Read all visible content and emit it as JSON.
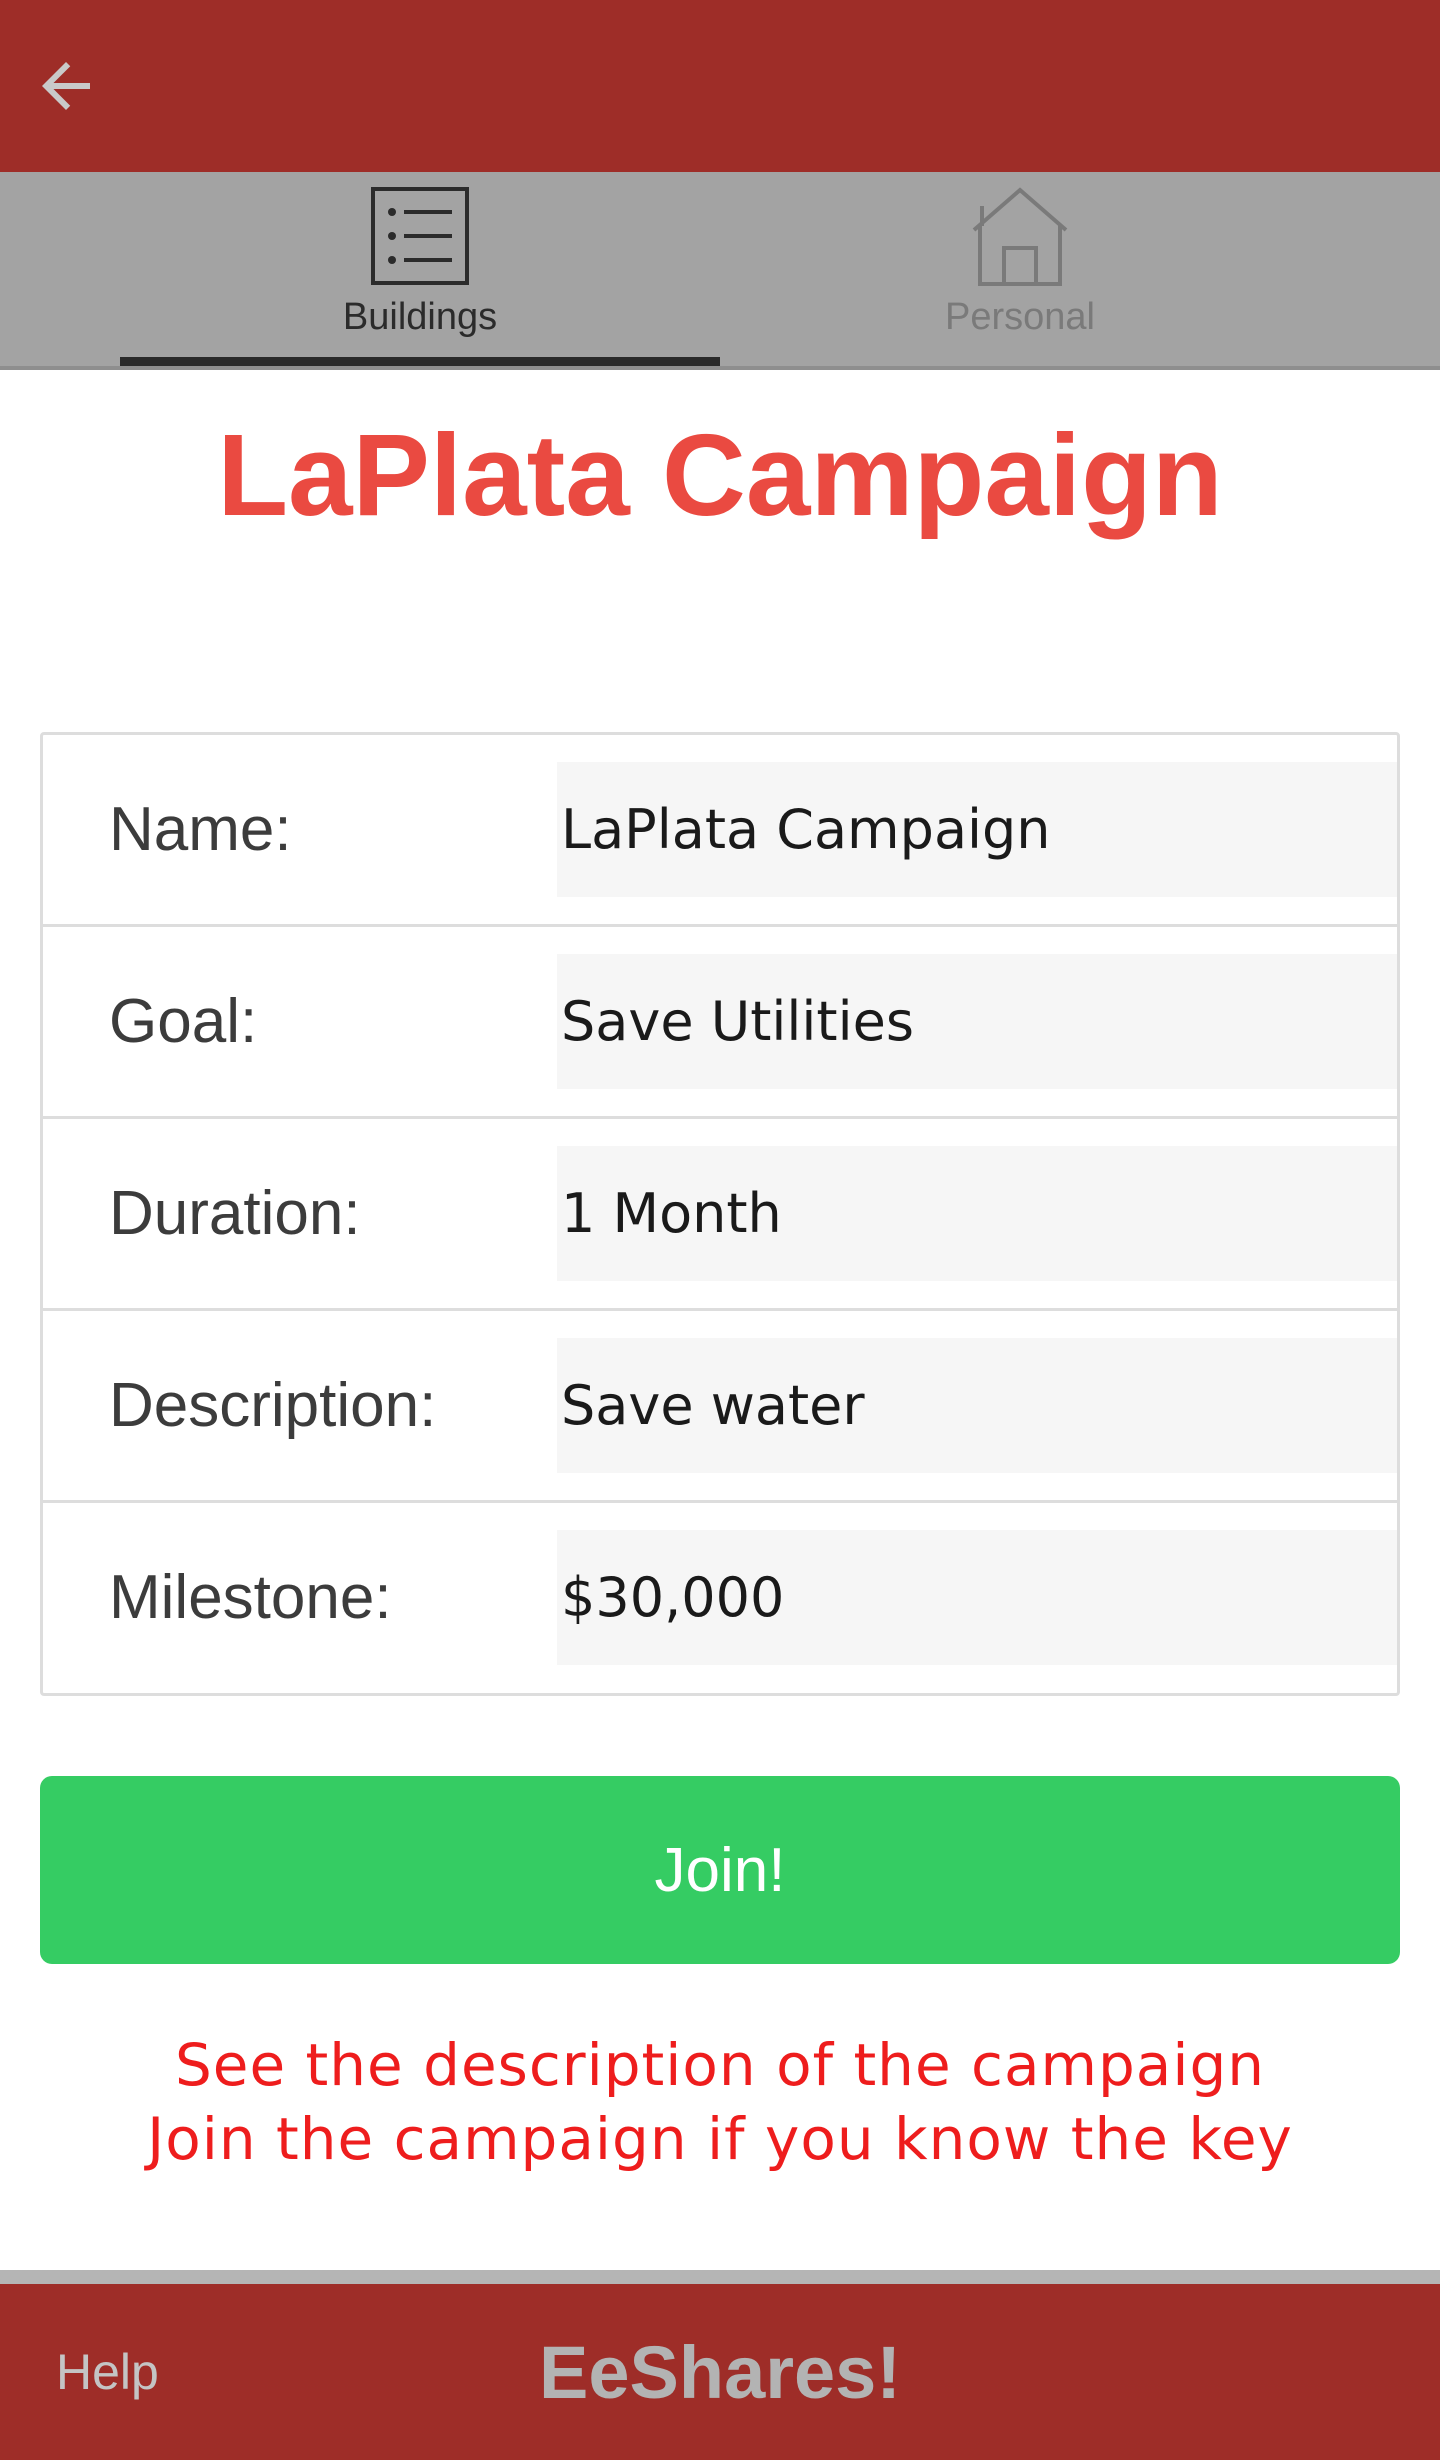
{
  "colors": {
    "app_bar": "#9e2d28",
    "tab_bar": "#a3a3a3",
    "title": "#ea4a41",
    "join_button": "#35cc63",
    "note_text": "#ee1d1d"
  },
  "header": {
    "back_icon": "arrow-left-icon"
  },
  "tabs": [
    {
      "label": "Buildings",
      "icon": "list-icon",
      "selected": true
    },
    {
      "label": "Personal",
      "icon": "home-icon",
      "selected": false
    }
  ],
  "page": {
    "title": "LaPlata Campaign"
  },
  "details": [
    {
      "label": "Name:",
      "value": "LaPlata Campaign"
    },
    {
      "label": "Goal:",
      "value": "Save Utilities"
    },
    {
      "label": "Duration:",
      "value": "1 Month"
    },
    {
      "label": "Description:",
      "value": "Save water"
    },
    {
      "label": "Milestone:",
      "value": "$30,000"
    }
  ],
  "actions": {
    "join_label": "Join!"
  },
  "notes": {
    "line1": "See the description of the campaign",
    "line2": "Join the campaign if you know the key"
  },
  "footer": {
    "help_label": "Help",
    "brand": "EeShares!"
  }
}
